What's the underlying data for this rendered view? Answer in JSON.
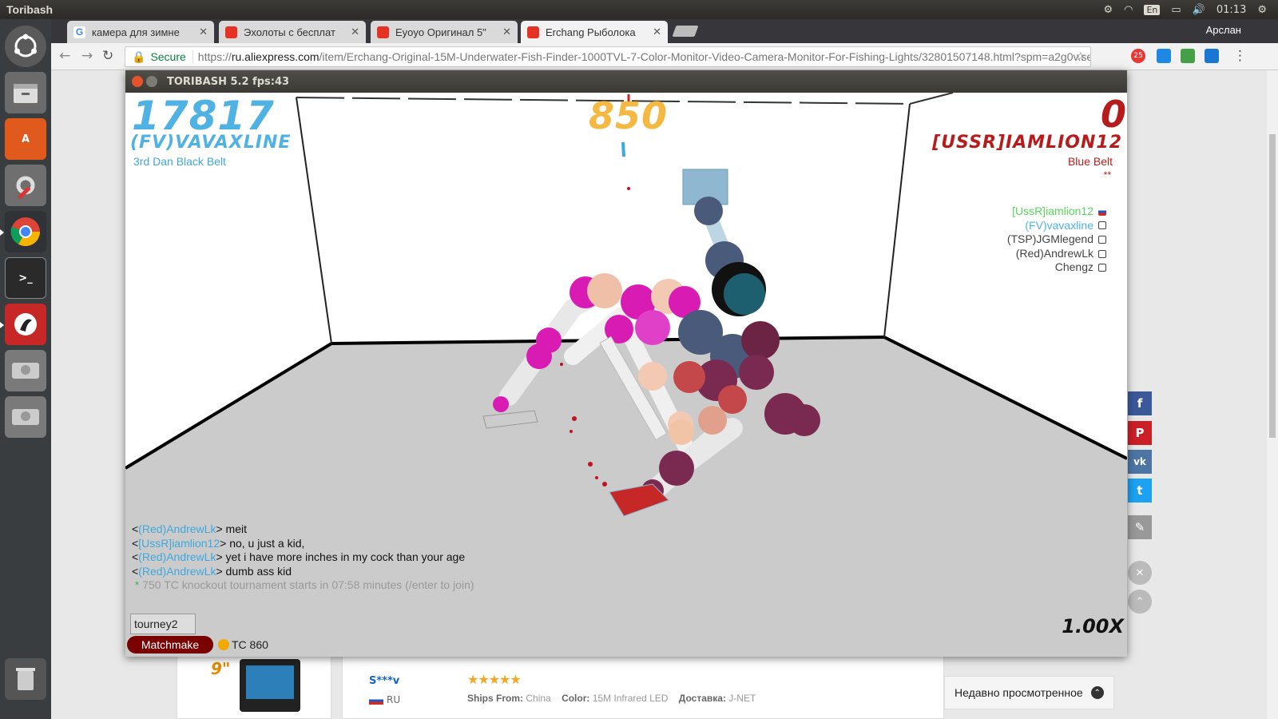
{
  "os": {
    "app_title": "Toribash",
    "lang": "En",
    "time": "01:13",
    "user": "Арслан"
  },
  "browser": {
    "tabs": [
      {
        "label": "камера для зимне",
        "icon": "google-icon"
      },
      {
        "label": "Эхолоты с бесплат",
        "icon": "aliexpress-icon"
      },
      {
        "label": "Eyoyo Оригинал 5\"",
        "icon": "aliexpress-icon"
      },
      {
        "label": "Erchang Рыболока",
        "icon": "aliexpress-icon"
      }
    ],
    "secure_label": "Secure",
    "url_proto": "https://",
    "url_host": "ru.aliexpress.com",
    "url_path": "/item/Erchang-Original-15M-Underwater-Fish-Finder-1000TVL-7-Color-Monitor-Video-Camera-Monitor-For-Fishing-Lights/32801507148.html?spm=a2g0v.se...",
    "ext_badge": "25"
  },
  "game": {
    "window_title": "TORIBASH 5.2 fps:43",
    "left_score": "17817",
    "left_name": "(FV)VAVAXLINE",
    "left_belt": "3rd Dan Black Belt",
    "center_score": "850",
    "right_score": "0",
    "right_name": "[USSR]IAMLION12",
    "right_belt": "Blue Belt",
    "right_stars": "**",
    "players": [
      {
        "name": "[UssR]iamlion12",
        "color": "#59d65b"
      },
      {
        "name": "(FV)vavaxline",
        "color": "#4fb2e3"
      },
      {
        "name": "(TSP)JGMlegend",
        "color": "#444444"
      },
      {
        "name": "(Red)AndrewLk",
        "color": "#444444"
      },
      {
        "name": "Chengz",
        "color": "#444444"
      }
    ],
    "chat": [
      {
        "name": "(Red)AndrewLk",
        "text": "meit"
      },
      {
        "name": "[UssR]iamlion12",
        "text": "no, u just a kid,"
      },
      {
        "name": "(Red)AndrewLk",
        "text": "yet i have more inches in my cock than your age"
      },
      {
        "name": "(Red)AndrewLk",
        "text": "dumb ass kid"
      }
    ],
    "system_message": "750 TC knockout tournament starts in 07:58 minutes (/enter to join)",
    "chat_input": "tourney2",
    "matchmake_label": "Matchmake",
    "tc_label": "TC 860",
    "speed": "1.00X"
  },
  "page": {
    "seller": "S***v",
    "country": "RU",
    "ships_from_label": "Ships From:",
    "ships_from_value": "China",
    "color_label": "Color:",
    "color_value": "15M Infrared LED",
    "delivery_label": "Доставка:",
    "delivery_value": "J-NET",
    "thumb_label": "9\"",
    "recent_label": "Недавно просмотренное",
    "colors": {
      "aliexpress": "#e43225",
      "facebook": "#3b5998",
      "pinterest": "#cb2027",
      "vk": "#4c75a3",
      "twitter": "#1da1f2"
    }
  }
}
